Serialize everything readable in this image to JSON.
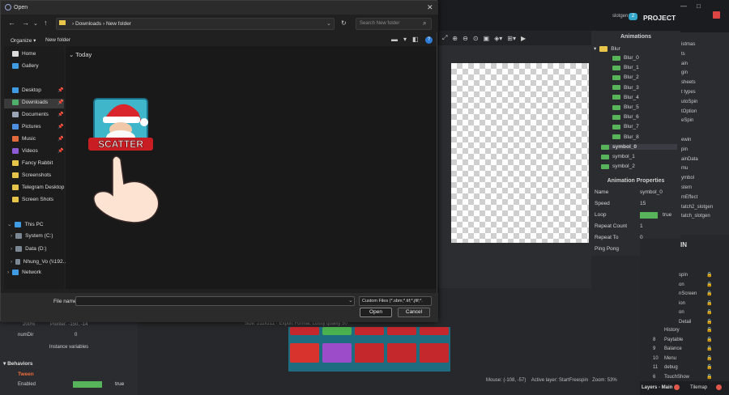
{
  "dialog": {
    "title": "Open",
    "path": {
      "segments": [
        "Downloads",
        "New folder"
      ],
      "separator": "›"
    },
    "search_placeholder": "Search New folder",
    "organize_label": "Organize ▾",
    "new_folder_label": "New folder",
    "group_header": "Today",
    "sidebar": {
      "quick": [
        {
          "label": "Home",
          "icon": "home-icon"
        },
        {
          "label": "Gallery",
          "icon": "gallery-icon"
        }
      ],
      "pinned": [
        {
          "label": "Desktop",
          "icon": "desktop-icon"
        },
        {
          "label": "Downloads",
          "icon": "download-icon",
          "selected": true
        },
        {
          "label": "Documents",
          "icon": "documents-icon"
        },
        {
          "label": "Pictures",
          "icon": "pictures-icon"
        },
        {
          "label": "Music",
          "icon": "music-icon"
        },
        {
          "label": "Videos",
          "icon": "videos-icon"
        },
        {
          "label": "Fancy Rabbit",
          "icon": "folder-icon"
        },
        {
          "label": "Screenshots",
          "icon": "folder-icon"
        },
        {
          "label": "Telegram Desktop",
          "icon": "folder-icon"
        },
        {
          "label": "Screen Shots",
          "icon": "folder-icon"
        }
      ],
      "this_pc": "This PC",
      "drives": [
        "System (C:)",
        "Data (D:)",
        "Nhung_Vo (\\\\192..."
      ],
      "network": "Network"
    },
    "file_name_label": "File name:",
    "file_name_value": "",
    "file_type": "Custom Files (*.sbm;*.tif;*.jfif;*.",
    "open_label": "Open",
    "cancel_label": "Cancel",
    "thumbnail_text": "SCATTER"
  },
  "app": {
    "user": "slotgen",
    "user_badge": "2",
    "project_title": "PROJECT",
    "animations_title": "Animations",
    "anim_folder": "Blur",
    "anim_frames": [
      "Blur_0",
      "Blur_1",
      "Blur_2",
      "Blur_3",
      "Blur_4",
      "Blur_5",
      "Blur_6",
      "Blur_7",
      "Blur_8"
    ],
    "anim_list": [
      "symbol_0",
      "symbol_1",
      "symbol_2"
    ],
    "anim_props_title": "Animation Properties",
    "props": [
      {
        "name": "Name",
        "value": "symbol_0"
      },
      {
        "name": "Speed",
        "value": "15"
      },
      {
        "name": "Loop",
        "value": "true"
      },
      {
        "name": "Repeat Count",
        "value": "1"
      },
      {
        "name": "Repeat To",
        "value": "0"
      },
      {
        "name": "Ping Pong",
        "value": "false"
      }
    ],
    "project_items": [
      "istmas",
      "ts",
      "ain",
      "gin",
      "sheets",
      "t types",
      "utoSpin",
      "tOption",
      "eSpin",
      "",
      "ewin",
      "pin",
      "ainData",
      "mu",
      "ymbol",
      "stem",
      "mEffect",
      "tatch2_slotgen",
      "tatch_slotgen"
    ],
    "right_section": "IN",
    "right_list": [
      "spin",
      "on",
      "nScreen",
      "ion",
      "on",
      "Detail"
    ],
    "numbered": [
      {
        "n": "",
        "label": "History"
      },
      {
        "n": "8",
        "label": "Paytable"
      },
      {
        "n": "9",
        "label": "Balance"
      },
      {
        "n": "10",
        "label": "Menu"
      },
      {
        "n": "11",
        "label": "debug"
      },
      {
        "n": "6",
        "label": "TouchShow"
      }
    ],
    "bottom_left": {
      "line1": "200%",
      "line1b": "Pointer: -150, -14",
      "row_label": "numDir",
      "row_value": "0",
      "instance_vars": "Instance variables",
      "behaviors": "Behaviors",
      "tween": "Tween",
      "enabled_label": "Enabled",
      "enabled_value": "true"
    },
    "canvas_info": "Size: 211x211 · Export Format: Lossy quality 50",
    "status": {
      "mouse": "Mouse: (-108, -57)",
      "active_layer": "Active layer: StartFreespin",
      "zoom": "Zoom: 53%"
    },
    "layers_tab": "Layers - Main",
    "tilemap_tab": "Tilemap"
  },
  "colors": {
    "accent_blue": "#2f7bd8",
    "loop_green": "#58b45a",
    "pingpong_red": "#e2574c",
    "teal_badge": "#33a6c9"
  }
}
